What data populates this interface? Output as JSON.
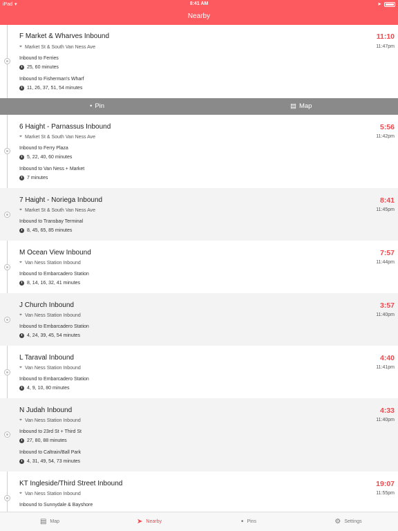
{
  "status": {
    "device": "iPad",
    "time": "8:41 AM"
  },
  "nav": {
    "title": "Nearby"
  },
  "actions": {
    "pin": "Pin",
    "map": "Map"
  },
  "predictions": [
    {
      "line": "F Market & Wharves Inbound",
      "time": "11:10",
      "stop": "Market St & South Van Ness Ave",
      "clock": "11:47pm",
      "dirs": [
        {
          "dest": "Inbound to Ferries",
          "routes": "25, 60 minutes"
        },
        {
          "dest": "Inbound to Fisherman's Wharf",
          "routes": "11, 26, 37, 51, 54 minutes"
        }
      ]
    },
    {
      "line": "6 Haight - Parnassus Inbound",
      "time": "5:56",
      "stop": "Market St & South Van Ness Ave",
      "clock": "11:42pm",
      "dirs": [
        {
          "dest": "Inbound to Ferry Plaza",
          "routes": "5, 22, 40, 60 minutes"
        },
        {
          "dest": "Inbound to Van Ness + Market",
          "routes": "7 minutes"
        }
      ]
    },
    {
      "line": "7 Haight - Noriega Inbound",
      "time": "8:41",
      "stop": "Market St & South Van Ness Ave",
      "clock": "11:45pm",
      "dirs": [
        {
          "dest": "Inbound to Transbay Terminal",
          "routes": "8, 45, 65, 85 minutes"
        }
      ]
    },
    {
      "line": "M Ocean View Inbound",
      "time": "7:57",
      "stop": "Van Ness Station Inbound",
      "clock": "11:44pm",
      "dirs": [
        {
          "dest": "Inbound to Embarcadero Station",
          "routes": "8, 14, 16, 32, 41 minutes"
        }
      ]
    },
    {
      "line": "J Church Inbound",
      "time": "3:57",
      "stop": "Van Ness Station Inbound",
      "clock": "11:40pm",
      "dirs": [
        {
          "dest": "Inbound to Embarcadero Station",
          "routes": "4, 24, 39, 45, 54 minutes"
        }
      ]
    },
    {
      "line": "L Taraval Inbound",
      "time": "4:40",
      "stop": "Van Ness Station Inbound",
      "clock": "11:41pm",
      "dirs": [
        {
          "dest": "Inbound to Embarcadero Station",
          "routes": "4, 9, 10, 80 minutes"
        }
      ]
    },
    {
      "line": "N Judah Inbound",
      "time": "4:33",
      "stop": "Van Ness Station Inbound",
      "clock": "11:40pm",
      "dirs": [
        {
          "dest": "Inbound to 23rd St + Third St",
          "routes": "27, 80, 88 minutes"
        },
        {
          "dest": "Inbound to Caltrain/Ball Park",
          "routes": "4, 31, 49, 54, 73 minutes"
        }
      ]
    },
    {
      "line": "KT Ingleside/Third Street Inbound",
      "time": "19:07",
      "stop": "Van Ness Station Inbound",
      "clock": "11:55pm",
      "dirs": [
        {
          "dest": "Inbound to Sunnydale & Bayshore",
          "routes": ""
        }
      ]
    }
  ],
  "tabs": [
    {
      "label": "Map",
      "icon": "map-icon"
    },
    {
      "label": "Nearby",
      "icon": "location-arrow-icon"
    },
    {
      "label": "Pins",
      "icon": "pin-icon"
    },
    {
      "label": "Settings",
      "icon": "gear-icon"
    }
  ],
  "colors": {
    "accent": "#fc5a5e",
    "time_red": "#f0474c",
    "action_bar": "#8a8a8a"
  }
}
